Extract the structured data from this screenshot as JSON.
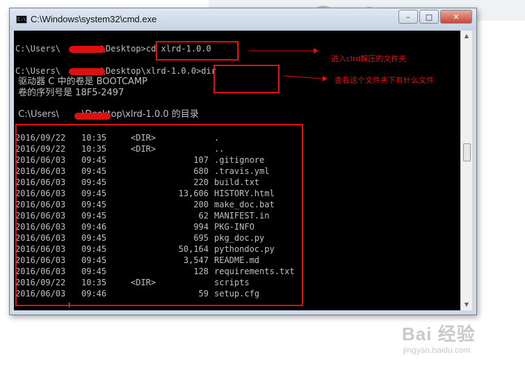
{
  "window": {
    "title": "C:\\Windows\\system32\\cmd.exe",
    "app_icon_text": "C:\\",
    "minimize_glyph": "–",
    "maximize_glyph": "□",
    "close_glyph": "✕"
  },
  "console": {
    "prompt1": "C:\\Users\\        \\Desktop>cd xlrd-1.0.0",
    "prompt2": "C:\\Users\\        \\Desktop\\xlrd-1.0.0>dir",
    "volume_line": " 驱动器 C 中的卷是 BOOTCAMP",
    "serial_line": " 卷的序列号是 18F5-2497",
    "dir_of_line": " C:\\Users\\        \\Desktop\\xlrd-1.0.0 的目录",
    "entries": [
      {
        "date": "2016/09/22",
        "time": "10:35",
        "dir": "<DIR>",
        "size": "",
        "name": "."
      },
      {
        "date": "2016/09/22",
        "time": "10:35",
        "dir": "<DIR>",
        "size": "",
        "name": ".."
      },
      {
        "date": "2016/06/03",
        "time": "09:45",
        "dir": "",
        "size": "107",
        "name": ".gitignore"
      },
      {
        "date": "2016/06/03",
        "time": "09:45",
        "dir": "",
        "size": "680",
        "name": ".travis.yml"
      },
      {
        "date": "2016/06/03",
        "time": "09:45",
        "dir": "",
        "size": "220",
        "name": "build.txt"
      },
      {
        "date": "2016/06/03",
        "time": "09:45",
        "dir": "",
        "size": "13,606",
        "name": "HISTORY.html"
      },
      {
        "date": "2016/06/03",
        "time": "09:45",
        "dir": "",
        "size": "200",
        "name": "make_doc.bat"
      },
      {
        "date": "2016/06/03",
        "time": "09:45",
        "dir": "",
        "size": "62",
        "name": "MANIFEST.in"
      },
      {
        "date": "2016/06/03",
        "time": "09:46",
        "dir": "",
        "size": "994",
        "name": "PKG-INFO"
      },
      {
        "date": "2016/06/03",
        "time": "09:45",
        "dir": "",
        "size": "695",
        "name": "pkg_doc.py"
      },
      {
        "date": "2016/06/03",
        "time": "09:45",
        "dir": "",
        "size": "50,164",
        "name": "pythondoc.py"
      },
      {
        "date": "2016/06/03",
        "time": "09:45",
        "dir": "",
        "size": "3,547",
        "name": "README.md"
      },
      {
        "date": "2016/06/03",
        "time": "09:45",
        "dir": "",
        "size": "128",
        "name": "requirements.txt"
      },
      {
        "date": "2016/09/22",
        "time": "10:35",
        "dir": "<DIR>",
        "size": "",
        "name": "scripts"
      },
      {
        "date": "2016/06/03",
        "time": "09:46",
        "dir": "",
        "size": "59",
        "name": "setup.cfg"
      }
    ],
    "cursor_glyph": "+"
  },
  "annotations": {
    "cd_note": "进入clrd解压的文件夹",
    "dir_note": "查看这个文件夹下有什么文件"
  },
  "watermark": {
    "logo": "Bai 经验",
    "url": "jingyan.baidu.com"
  },
  "colors": {
    "console_bg": "#000000",
    "console_text": "#c0c0c0",
    "highlight": "#e01010"
  }
}
